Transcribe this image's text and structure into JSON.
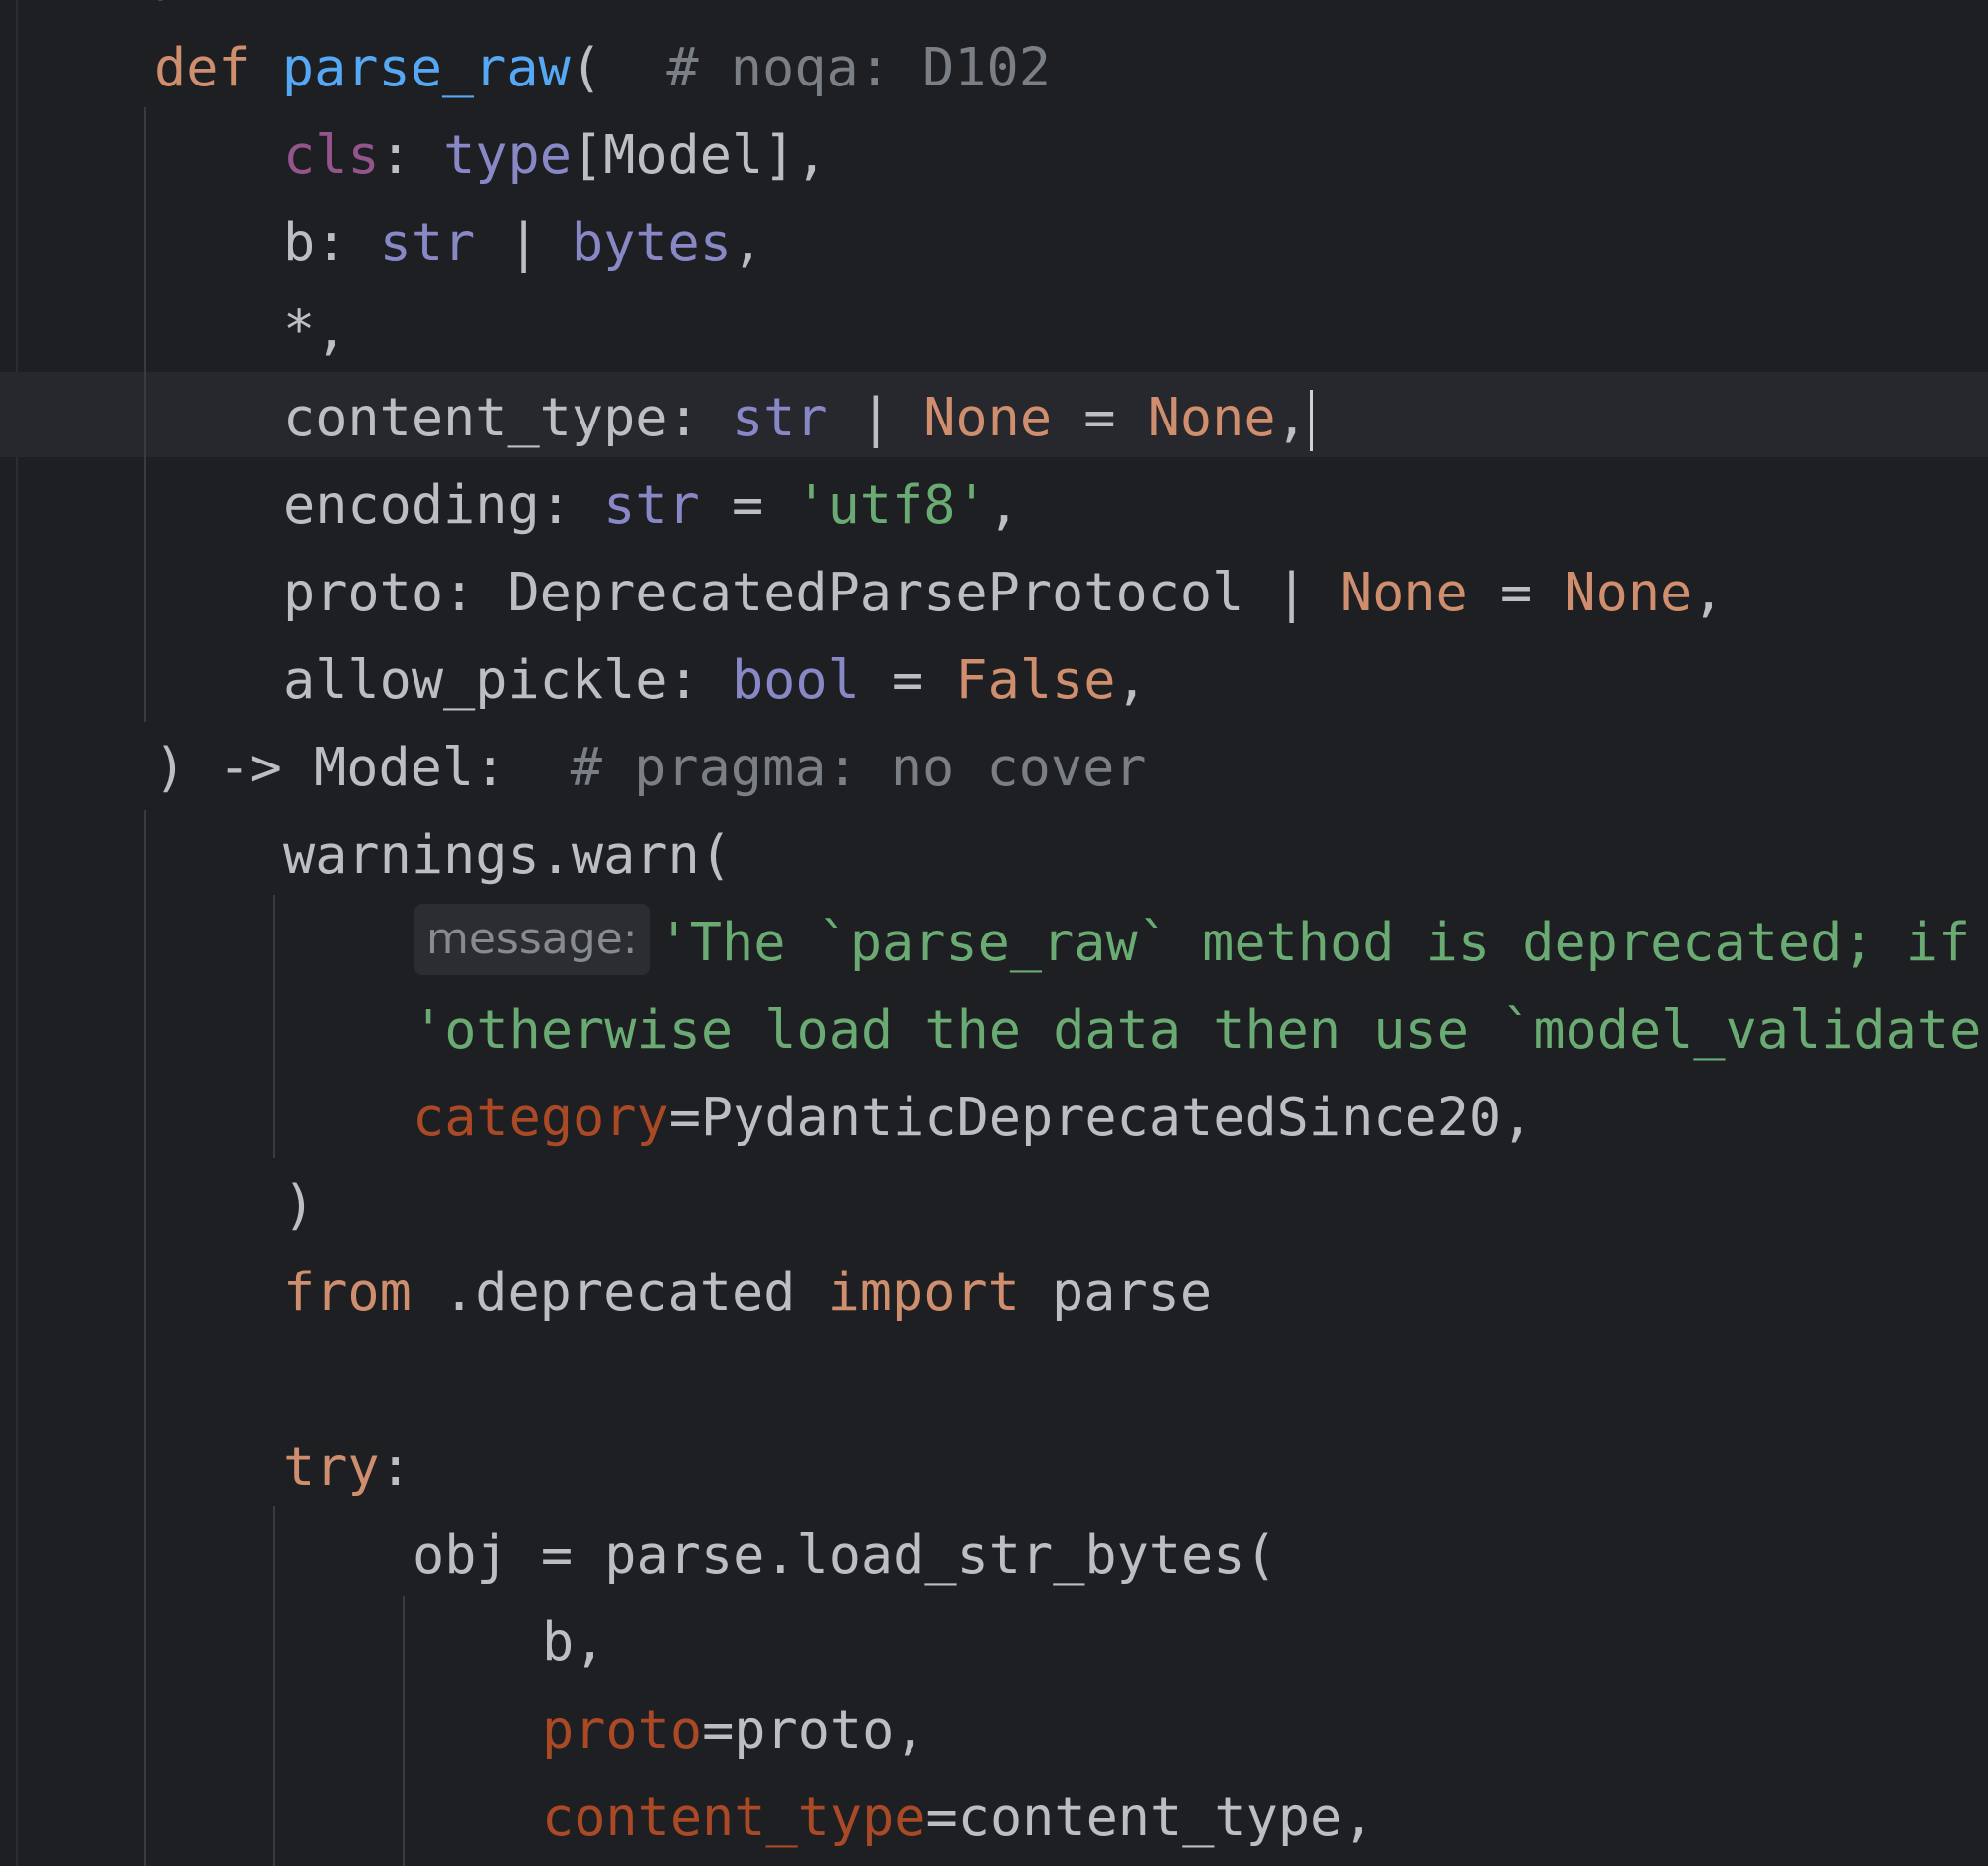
{
  "editor": {
    "top_fragment": ")",
    "lines": [
      {
        "id": "def",
        "parts": [
          {
            "t": "def",
            "c": "kw"
          },
          {
            "t": " "
          },
          {
            "t": "parse_raw",
            "c": "fn"
          },
          {
            "t": "(  "
          },
          {
            "t": "# noqa: D102",
            "c": "cm"
          }
        ]
      },
      {
        "id": "param-cls",
        "parts": [
          {
            "t": "cls",
            "c": "self"
          },
          {
            "t": ": "
          },
          {
            "t": "type",
            "c": "bi"
          },
          {
            "t": "[Model],"
          }
        ]
      },
      {
        "id": "param-b",
        "parts": [
          {
            "t": "b: "
          },
          {
            "t": "str",
            "c": "bi"
          },
          {
            "t": " | "
          },
          {
            "t": "bytes",
            "c": "bi"
          },
          {
            "t": ","
          }
        ]
      },
      {
        "id": "param-star",
        "parts": [
          {
            "t": "*,"
          }
        ]
      },
      {
        "id": "param-content-type",
        "current": true,
        "parts": [
          {
            "t": "content_type: "
          },
          {
            "t": "str",
            "c": "bi"
          },
          {
            "t": " | "
          },
          {
            "t": "None",
            "c": "kw"
          },
          {
            "t": " = "
          },
          {
            "t": "None",
            "c": "kw"
          },
          {
            "t": ","
          }
        ]
      },
      {
        "id": "param-encoding",
        "parts": [
          {
            "t": "encoding: "
          },
          {
            "t": "str",
            "c": "bi"
          },
          {
            "t": " = "
          },
          {
            "t": "'utf8'",
            "c": "str"
          },
          {
            "t": ","
          }
        ]
      },
      {
        "id": "param-proto",
        "parts": [
          {
            "t": "proto: DeprecatedParseProtocol | "
          },
          {
            "t": "None",
            "c": "kw"
          },
          {
            "t": " = "
          },
          {
            "t": "None",
            "c": "kw"
          },
          {
            "t": ","
          }
        ]
      },
      {
        "id": "param-allow-pickle",
        "parts": [
          {
            "t": "allow_pickle: "
          },
          {
            "t": "bool",
            "c": "bi"
          },
          {
            "t": " = "
          },
          {
            "t": "False",
            "c": "kw"
          },
          {
            "t": ","
          }
        ]
      },
      {
        "id": "signature-close",
        "parts": [
          {
            "t": ") -> Model:  "
          },
          {
            "t": "# pragma: no cover",
            "c": "cm"
          }
        ]
      },
      {
        "id": "warn-call",
        "parts": [
          {
            "t": "warnings.warn("
          }
        ]
      },
      {
        "id": "warn-message",
        "hint": "message:",
        "parts": [
          {
            "t": "'The `parse_raw` method is deprecated; if your data is JSON use `model_validate_json`, '",
            "c": "str"
          }
        ]
      },
      {
        "id": "warn-message-2",
        "parts": [
          {
            "t": "'otherwise load the data then use `model_validate` instead.',",
            "c": "str"
          }
        ]
      },
      {
        "id": "warn-category",
        "parts": [
          {
            "t": "category",
            "c": "named"
          },
          {
            "t": "=PydanticDeprecatedSince20,"
          }
        ]
      },
      {
        "id": "warn-close",
        "parts": [
          {
            "t": ")"
          }
        ]
      },
      {
        "id": "import",
        "parts": [
          {
            "t": "from",
            "c": "kw"
          },
          {
            "t": " .deprecated "
          },
          {
            "t": "import",
            "c": "kw"
          },
          {
            "t": " parse"
          }
        ]
      },
      {
        "id": "blank",
        "parts": []
      },
      {
        "id": "try",
        "parts": [
          {
            "t": "try",
            "c": "kw"
          },
          {
            "t": ":"
          }
        ]
      },
      {
        "id": "obj-assign",
        "parts": [
          {
            "t": "obj = parse.load_str_bytes("
          }
        ]
      },
      {
        "id": "arg-b",
        "parts": [
          {
            "t": "b,"
          }
        ]
      },
      {
        "id": "arg-proto",
        "parts": [
          {
            "t": "proto",
            "c": "named"
          },
          {
            "t": "=proto,"
          }
        ]
      },
      {
        "id": "arg-content-type",
        "parts": [
          {
            "t": "content_type",
            "c": "named"
          },
          {
            "t": "=content_type,"
          }
        ]
      }
    ]
  }
}
